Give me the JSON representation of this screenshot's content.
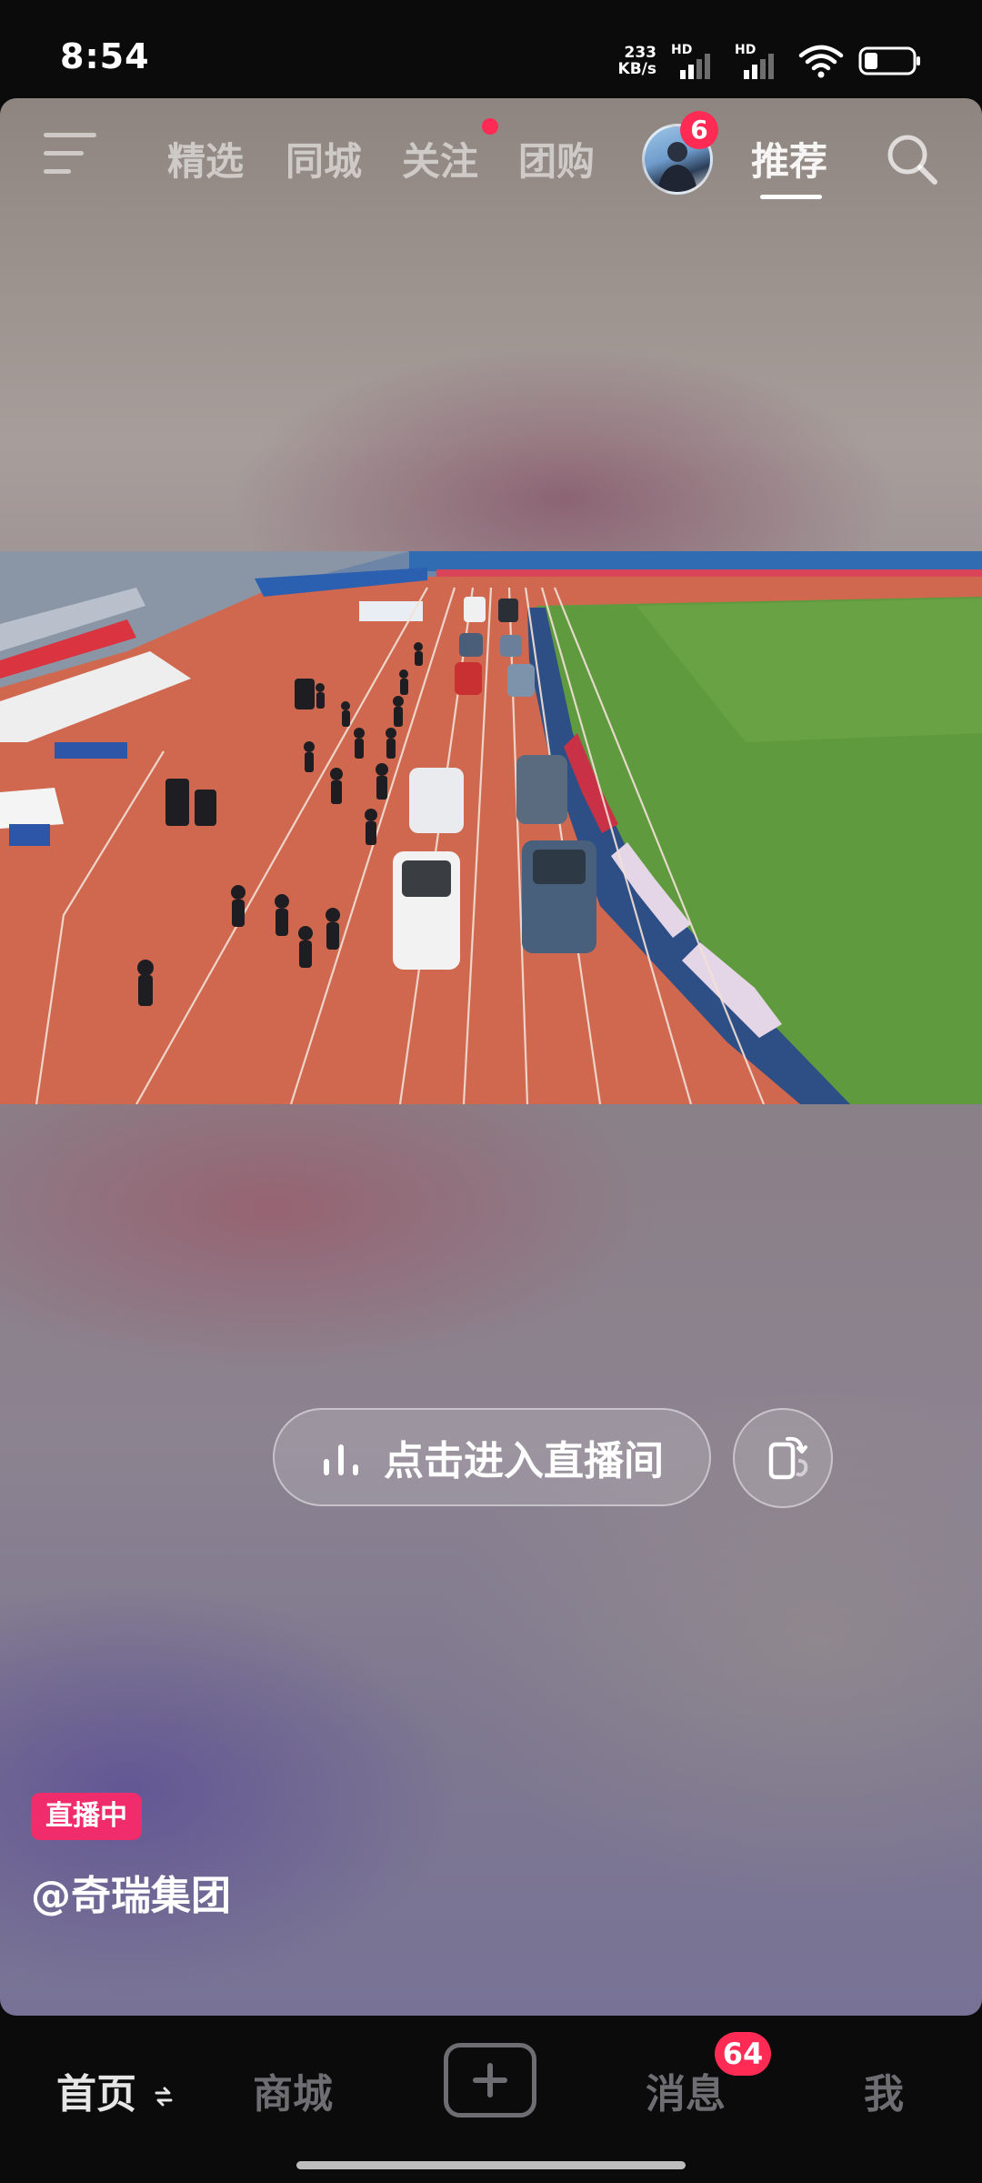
{
  "status_bar": {
    "time": "8:54",
    "net_speed_value": "233",
    "net_speed_unit": "KB/s",
    "sim1_tag": "HD",
    "sim2_tag": "HD",
    "battery_icon": "battery-low-icon",
    "wifi_icon": "wifi-icon"
  },
  "top_nav": {
    "menu_icon": "menu-icon",
    "tabs": [
      {
        "label": "精选"
      },
      {
        "label": "同城"
      },
      {
        "label": "关注"
      },
      {
        "label": "团购"
      },
      {
        "label": "推荐"
      }
    ],
    "active_tab": "推荐",
    "avatar_badge": "6",
    "search_icon": "search-icon"
  },
  "live": {
    "enter_button_label": "点击进入直播间",
    "enter_button_icon": "live-bars-icon",
    "rotate_icon": "rotate-screen-icon",
    "badge": "直播中",
    "author": "@奇瑞集团"
  },
  "bottom_nav": {
    "items": [
      {
        "label": "首页"
      },
      {
        "label": "商城"
      },
      {
        "label": "消息"
      },
      {
        "label": "我"
      }
    ],
    "messages_badge": "64",
    "create_icon": "plus-icon"
  },
  "colors": {
    "accent_red": "#ff2b54",
    "live_badge": "#f02c6c",
    "track": "#d2674f",
    "grass": "#5f9a3f"
  }
}
